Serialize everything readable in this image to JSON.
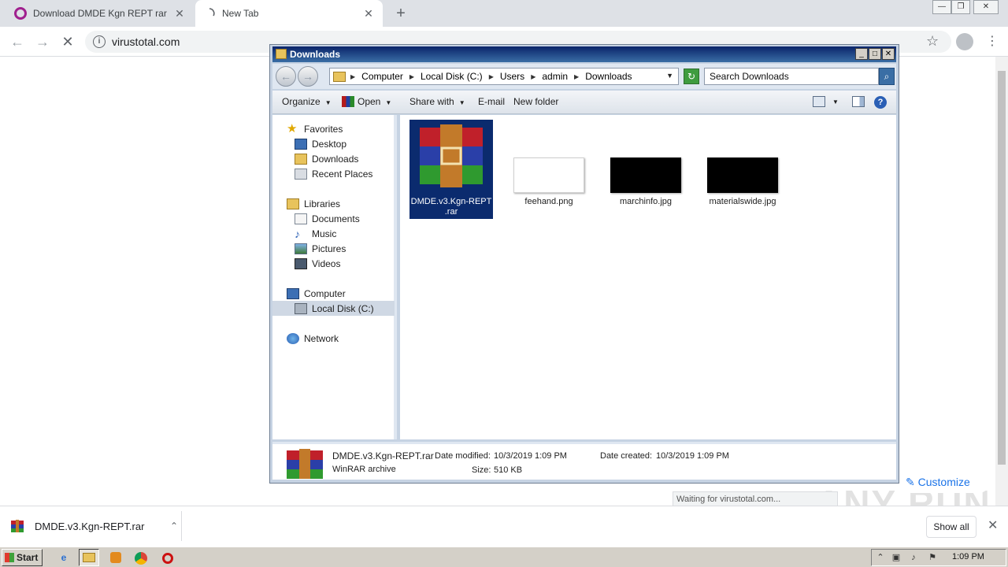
{
  "browser": {
    "tabs": [
      {
        "title": "Download DMDE Kgn REPT rar",
        "favicon": "opera-o-icon"
      },
      {
        "title": "New Tab",
        "favicon": "loading-spinner-icon"
      }
    ],
    "url": "virustotal.com",
    "status_text": "Waiting for virustotal.com...",
    "customize_label": "Customize",
    "watermark": "ANY RUN"
  },
  "explorer": {
    "window_title": "Downloads",
    "breadcrumb": [
      "Computer",
      "Local Disk (C:)",
      "Users",
      "admin",
      "Downloads"
    ],
    "search_placeholder": "Search Downloads",
    "commands": {
      "organize": "Organize",
      "open": "Open",
      "share_with": "Share with",
      "email": "E-mail",
      "new_folder": "New folder"
    },
    "nav": {
      "favorites": "Favorites",
      "desktop": "Desktop",
      "downloads": "Downloads",
      "recent_places": "Recent Places",
      "libraries": "Libraries",
      "documents": "Documents",
      "music": "Music",
      "pictures": "Pictures",
      "videos": "Videos",
      "computer": "Computer",
      "local_disk": "Local Disk (C:)",
      "network": "Network"
    },
    "files": [
      {
        "name": "DMDE.v3.Kgn-REPT .rar",
        "type": "rar",
        "selected": true
      },
      {
        "name": "feehand.png",
        "type": "image-light"
      },
      {
        "name": "marchinfo.jpg",
        "type": "image-dark"
      },
      {
        "name": "materialswide.jpg",
        "type": "image-dark"
      }
    ],
    "details": {
      "name": "DMDE.v3.Kgn-REPT.rar",
      "type": "WinRAR archive",
      "date_modified_label": "Date modified:",
      "date_modified": "10/3/2019 1:09 PM",
      "size_label": "Size:",
      "size": "510 KB",
      "date_created_label": "Date created:",
      "date_created": "10/3/2019 1:09 PM"
    }
  },
  "download_shelf": {
    "item": "DMDE.v3.Kgn-REPT.rar",
    "show_all": "Show all"
  },
  "taskbar": {
    "start": "Start",
    "clock": "1:09 PM"
  }
}
